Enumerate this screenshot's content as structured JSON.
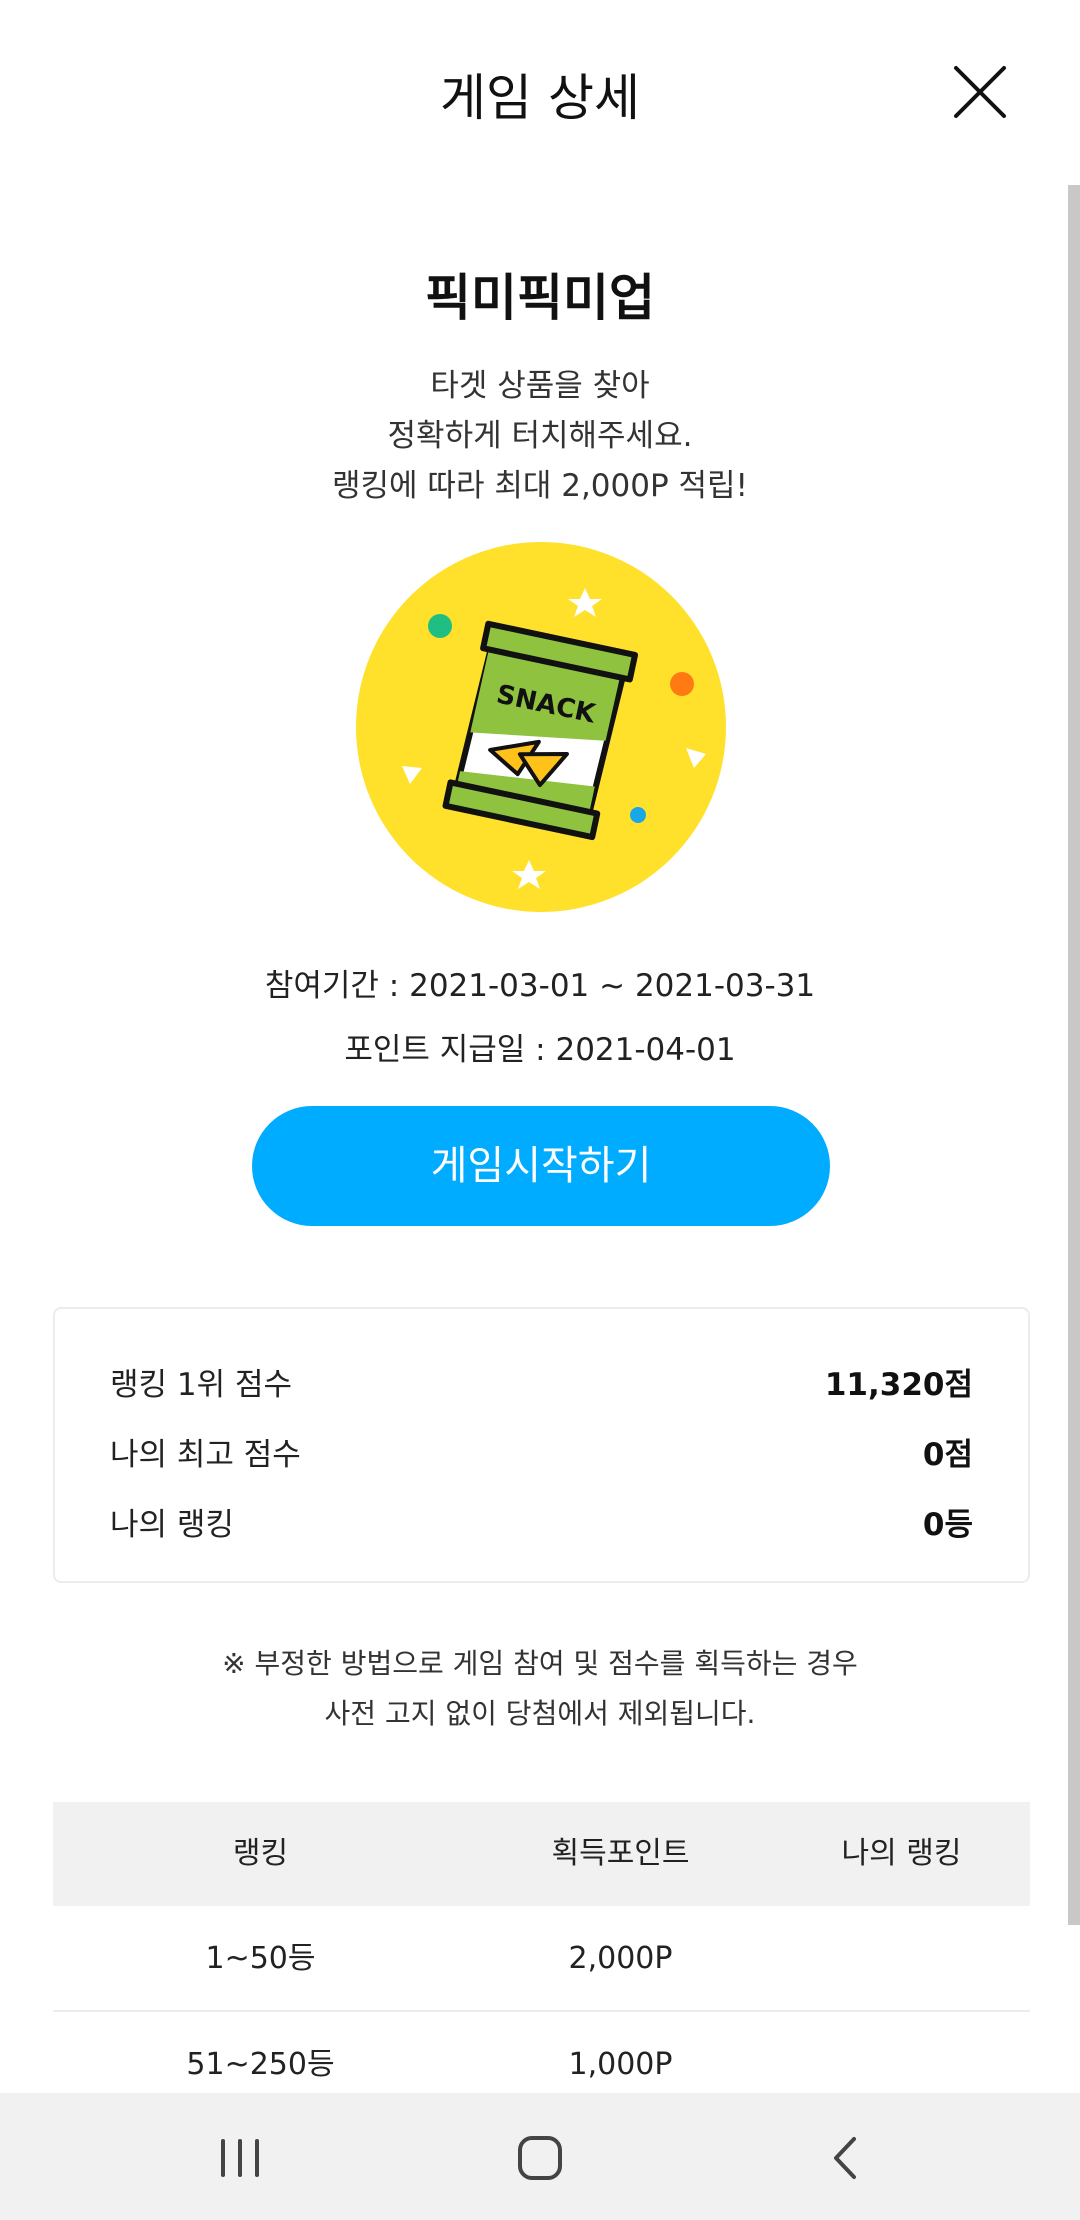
{
  "header": {
    "title": "게임 상세",
    "close_icon": "close-icon"
  },
  "game": {
    "name": "픽미픽미업",
    "description": [
      "타겟 상품을 찾아",
      "정확하게 터치해주세요.",
      "랭킹에 따라 최대 2,000P 적립!"
    ],
    "image_label": "SNACK",
    "image_icon": "snack-bag-icon",
    "circle_color": "#ffe02a"
  },
  "period": {
    "participation": "참여기간 : 2021-03-01 ~ 2021-03-31",
    "payout": "포인트 지급일 : 2021-04-01"
  },
  "start_button": {
    "label": "게임시작하기",
    "color": "#00acff"
  },
  "scores": [
    {
      "label": "랭킹 1위 점수",
      "value": "11,320점"
    },
    {
      "label": "나의 최고 점수",
      "value": "0점"
    },
    {
      "label": "나의 랭킹",
      "value": "0등"
    }
  ],
  "notice": [
    "※ 부정한 방법으로 게임 참여 및 점수를 획득하는 경우",
    "사전 고지 없이 당첨에서 제외됩니다."
  ],
  "ranking_table": {
    "headers": [
      "랭킹",
      "획득포인트",
      "나의 랭킹"
    ],
    "rows": [
      [
        "1~50등",
        "2,000P",
        ""
      ],
      [
        "51~250등",
        "1,000P",
        ""
      ]
    ]
  },
  "navbar": {
    "recent_icon": "recent-apps-icon",
    "home_icon": "home-icon",
    "back_icon": "back-icon"
  }
}
